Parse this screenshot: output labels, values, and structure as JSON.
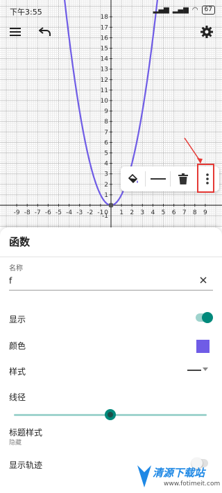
{
  "status_bar": {
    "time": "下午3:55",
    "battery": "67"
  },
  "graph": {
    "x_ticks": [
      "-9",
      "-8",
      "-7",
      "-6",
      "-5",
      "-4",
      "-3",
      "-2",
      "-1",
      "1",
      "2",
      "3",
      "4",
      "5",
      "6",
      "7",
      "8",
      "9"
    ],
    "y_ticks": [
      "1",
      "2",
      "3",
      "4",
      "5",
      "6",
      "7",
      "8",
      "9",
      "10",
      "11",
      "12",
      "13",
      "14",
      "15",
      "16",
      "17",
      "18"
    ],
    "y_neg_ticks": [
      "-1"
    ],
    "origin_label": "0",
    "curve_color": "#6f5ce6",
    "function": "y = x^2"
  },
  "toolbar": {
    "menu_icon": "hamburger-menu-icon",
    "undo_icon": "undo-icon",
    "settings_icon": "gear-icon"
  },
  "float_toolbar": {
    "fill_icon": "paint-bucket-icon",
    "line_icon": "line-style-icon",
    "delete_icon": "trash-icon",
    "more_icon": "more-vertical-icon"
  },
  "panel": {
    "title": "函数",
    "name_label": "名称",
    "name_value": "f",
    "show_label": "显示",
    "show_enabled": true,
    "color_label": "颜色",
    "color_value": "#6f5ce6",
    "style_label": "样式",
    "line_width_label": "线径",
    "line_width_value": 0.5,
    "caption_style_label": "标题样式",
    "caption_style_value": "隐藏",
    "trace_label": "显示轨迹",
    "trace_enabled": false
  },
  "watermark": {
    "text": "清源下载站",
    "url": "www.fotimeit.com"
  }
}
